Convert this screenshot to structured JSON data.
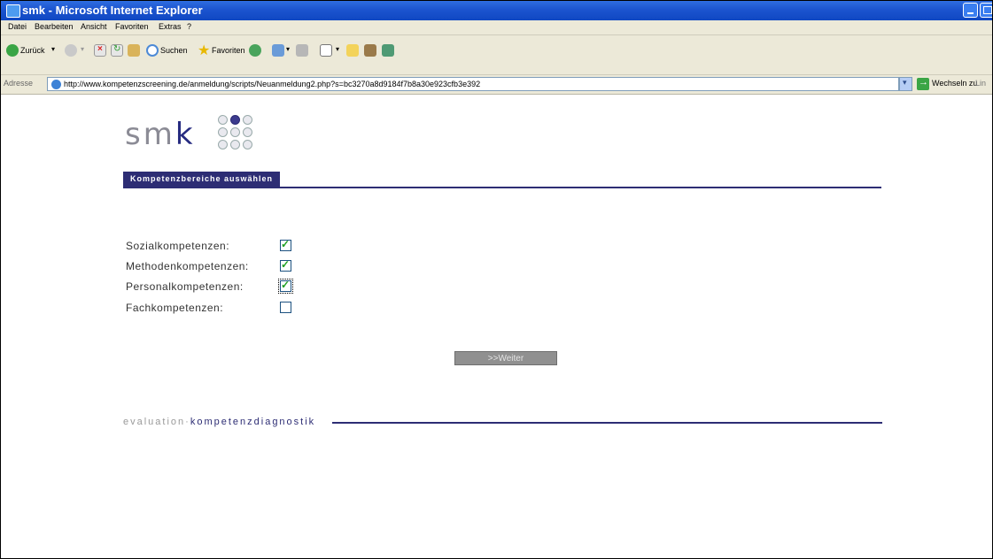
{
  "window": {
    "title": "smk - Microsoft Internet Explorer"
  },
  "menu": {
    "items": [
      "Datei",
      "Bearbeiten",
      "Ansicht",
      "Favoriten",
      "Extras",
      "?"
    ]
  },
  "toolbar": {
    "back_label": "Zurück",
    "search_label": "Suchen",
    "favorites_label": "Favoriten"
  },
  "address": {
    "label": "Adresse",
    "url": "http://www.kompetenzscreening.de/anmeldung/scripts/Neuanmeldung2.php?s=bc3270a8d9184f7b8a30e923cfb3e392",
    "go_label": "Wechseln zu",
    "links_label": "Lin"
  },
  "page": {
    "logo_prefix": "sm",
    "logo_suffix": "k",
    "section_title": "Kompetenzbereiche auswählen",
    "options": [
      {
        "label": "Sozialkompetenzen:",
        "checked": true
      },
      {
        "label": "Methodenkompetenzen:",
        "checked": true
      },
      {
        "label": "Personalkompetenzen:",
        "checked": true
      },
      {
        "label": "Fachkompetenzen:",
        "checked": false
      }
    ],
    "next_button": ">>Weiter",
    "footer_light": "evaluation·",
    "footer_strong": "kompetenzdiagnostik"
  },
  "colors": {
    "brand": "#2d2d74",
    "titlebar": "#1c54cf",
    "check": "#21a121"
  }
}
